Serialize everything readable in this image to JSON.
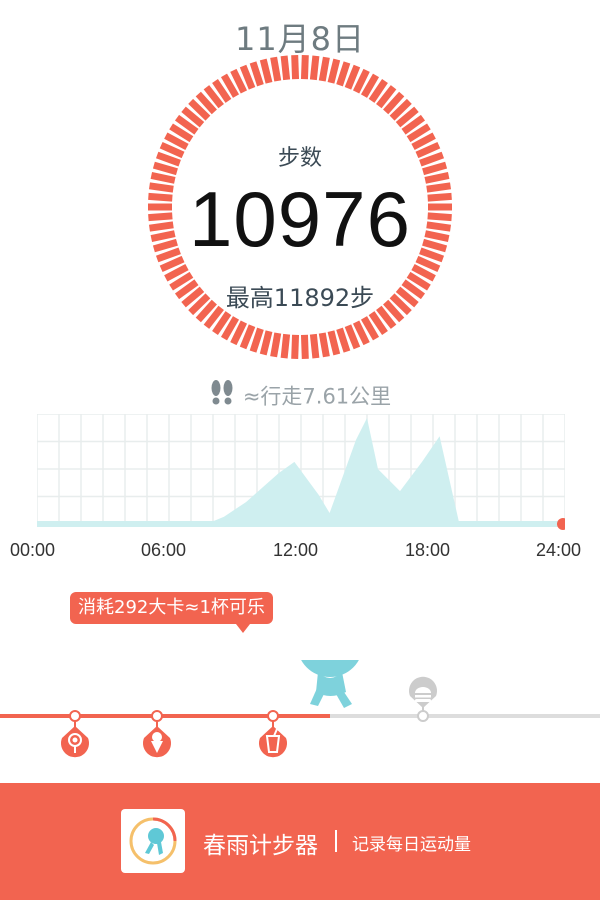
{
  "date": "11月8日",
  "steps": {
    "label": "步数",
    "value": "10976",
    "max_label": "最高11892步"
  },
  "distance": {
    "text": "≈行走7.61公里",
    "icon": "footprints-icon"
  },
  "colors": {
    "accent": "#f26450",
    "chart_fill": "#cfeff0",
    "grid": "#e8eded",
    "mascot": "#7ed2dc",
    "crown": "#f7d33a"
  },
  "chart_data": {
    "type": "area",
    "x": [
      0,
      7.7,
      8.5,
      9.5,
      11,
      11.7,
      12.8,
      13.3,
      14.5,
      15,
      15.5,
      16.5,
      17.5,
      18.3,
      19.2,
      24
    ],
    "values": [
      0,
      0,
      200,
      600,
      1400,
      1700,
      800,
      300,
      2300,
      2900,
      1500,
      900,
      1700,
      2400,
      0,
      0
    ],
    "xlim": [
      0,
      24
    ],
    "x_ticks": [
      "00:00",
      "06:00",
      "12:00",
      "18:00",
      "24:00"
    ],
    "grid": true,
    "title": "",
    "xlabel": "",
    "ylabel": ""
  },
  "calories": {
    "text": "消耗292大卡≈1杯可乐"
  },
  "timeline": {
    "progress": 0.55,
    "items": [
      {
        "icon": "lollipop-icon",
        "active": true
      },
      {
        "icon": "ice-cream-icon",
        "active": true
      },
      {
        "icon": "cola-cup-icon",
        "active": true
      },
      {
        "icon": "burger-icon",
        "active": false
      }
    ]
  },
  "footer": {
    "app_name": "春雨计步器",
    "slogan": "记录每日运动量",
    "icon": "app-logo-icon"
  }
}
